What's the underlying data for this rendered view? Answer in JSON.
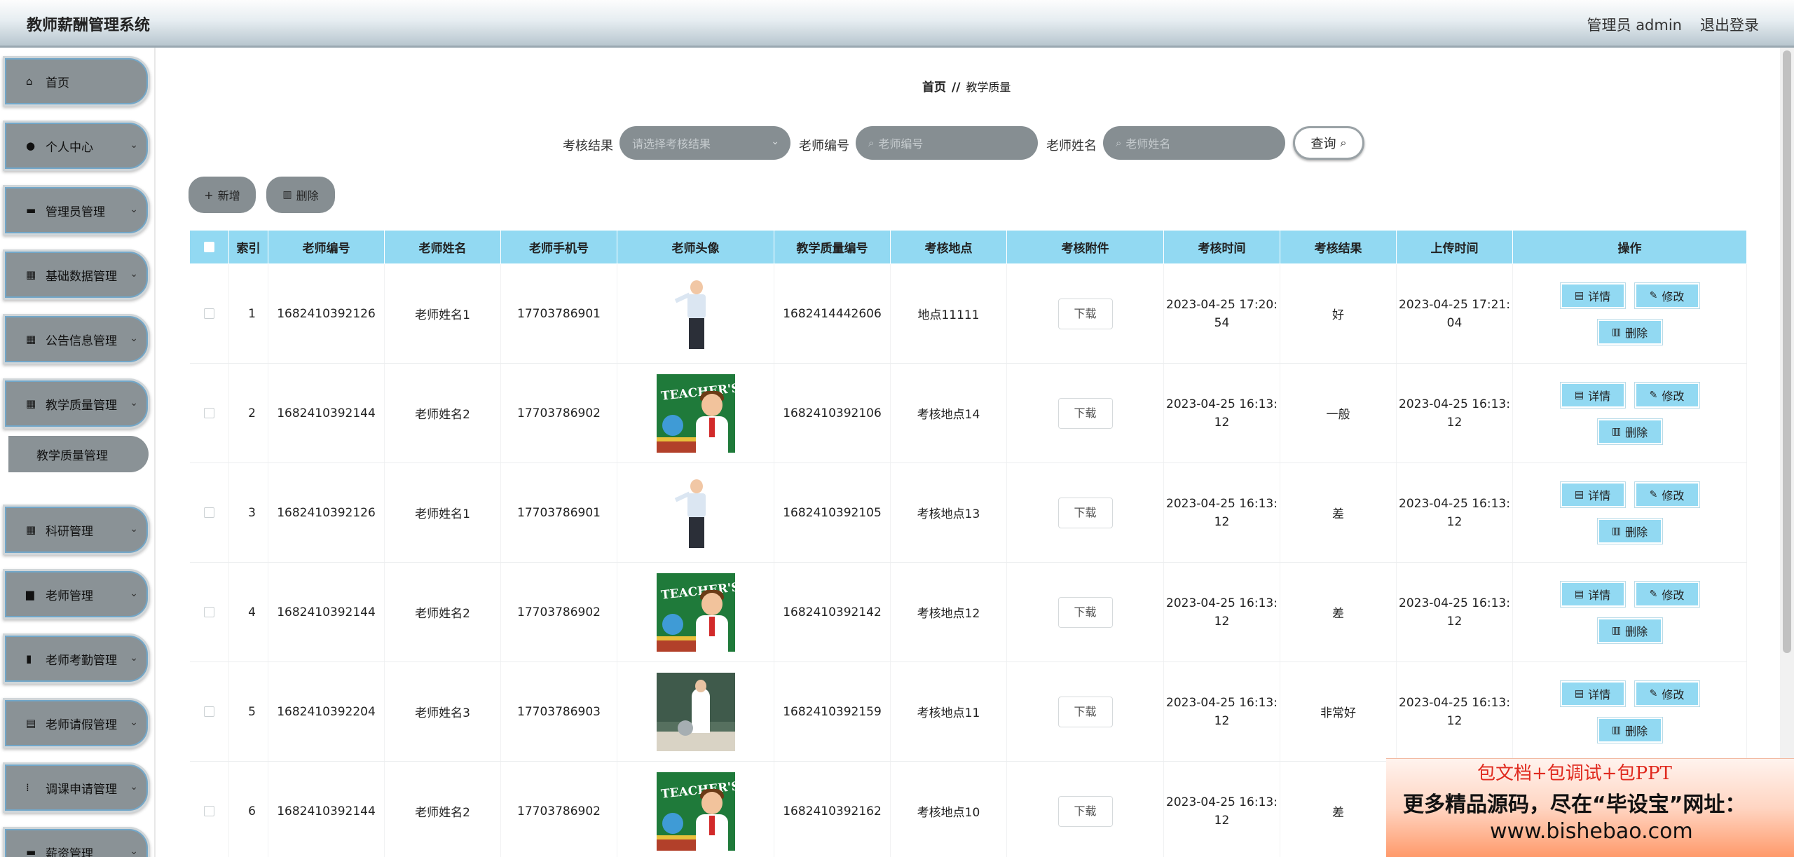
{
  "app": {
    "title": "教师薪酬管理系统",
    "user_label": "管理员 admin",
    "logout_label": "退出登录"
  },
  "sidebar": {
    "items": [
      {
        "label": "首页",
        "icon": "home-icon",
        "glyph": "⌂"
      },
      {
        "label": "个人中心",
        "icon": "user-icon",
        "glyph": "●"
      },
      {
        "label": "管理员管理",
        "icon": "chat-icon",
        "glyph": "▬"
      },
      {
        "label": "基础数据管理",
        "icon": "grid-icon",
        "glyph": "▦"
      },
      {
        "label": "公告信息管理",
        "icon": "grid-icon",
        "glyph": "▦"
      },
      {
        "label": "教学质量管理",
        "icon": "grid-icon",
        "glyph": "▦"
      },
      {
        "label": "科研管理",
        "icon": "grid-icon",
        "glyph": "▦"
      },
      {
        "label": "老师管理",
        "icon": "briefcase-icon",
        "glyph": "▆"
      },
      {
        "label": "老师考勤管理",
        "icon": "bar-chart-icon",
        "glyph": "▮"
      },
      {
        "label": "老师请假管理",
        "icon": "clipboard-icon",
        "glyph": "▤"
      },
      {
        "label": "调课申请管理",
        "icon": "apps-icon",
        "glyph": "⁞"
      },
      {
        "label": "薪资管理",
        "icon": "wallet-icon",
        "glyph": "▬"
      }
    ],
    "submenu": {
      "label": "教学质量管理"
    },
    "chevron": "⌄"
  },
  "breadcrumb": {
    "home": "首页",
    "separator": "//",
    "current": "教学质量"
  },
  "search": {
    "result_label": "考核结果",
    "result_placeholder": "请选择考核结果",
    "teacher_no_label": "老师编号",
    "teacher_no_placeholder": "老师编号",
    "teacher_name_label": "老师姓名",
    "teacher_name_placeholder": "老师姓名",
    "query_label": "查询"
  },
  "actions": {
    "add_label": "新增",
    "delete_label": "删除"
  },
  "table": {
    "headers": [
      "索引",
      "老师编号",
      "老师姓名",
      "老师手机号",
      "老师头像",
      "教学质量编号",
      "考核地点",
      "考核附件",
      "考核时间",
      "考核结果",
      "上传时间",
      "操作"
    ],
    "download_label": "下载",
    "detail_label": "详情",
    "edit_label": "修改",
    "delete_label": "删除",
    "rows": [
      {
        "index": "1",
        "teacher_no": "1682410392126",
        "teacher_name": "老师姓名1",
        "phone": "17703786901",
        "avatar": "man",
        "quality_no": "1682414442606",
        "location": "地点11111",
        "exam_time_a": "2023-04-25 17:20:",
        "exam_time_b": "54",
        "result": "好",
        "upload_time_a": "2023-04-25 17:21:",
        "upload_time_b": "04"
      },
      {
        "index": "2",
        "teacher_no": "1682410392144",
        "teacher_name": "老师姓名2",
        "phone": "17703786902",
        "avatar": "card",
        "quality_no": "1682410392106",
        "location": "考核地点14",
        "exam_time_a": "2023-04-25 16:13:",
        "exam_time_b": "12",
        "result": "一般",
        "upload_time_a": "2023-04-25 16:13:",
        "upload_time_b": "12"
      },
      {
        "index": "3",
        "teacher_no": "1682410392126",
        "teacher_name": "老师姓名1",
        "phone": "17703786901",
        "avatar": "man",
        "quality_no": "1682410392105",
        "location": "考核地点13",
        "exam_time_a": "2023-04-25 16:13:",
        "exam_time_b": "12",
        "result": "差",
        "upload_time_a": "2023-04-25 16:13:",
        "upload_time_b": "12"
      },
      {
        "index": "4",
        "teacher_no": "1682410392144",
        "teacher_name": "老师姓名2",
        "phone": "17703786902",
        "avatar": "card",
        "quality_no": "1682410392142",
        "location": "考核地点12",
        "exam_time_a": "2023-04-25 16:13:",
        "exam_time_b": "12",
        "result": "差",
        "upload_time_a": "2023-04-25 16:13:",
        "upload_time_b": "12"
      },
      {
        "index": "5",
        "teacher_no": "1682410392204",
        "teacher_name": "老师姓名3",
        "phone": "17703786903",
        "avatar": "photo",
        "quality_no": "1682410392159",
        "location": "考核地点11",
        "exam_time_a": "2023-04-25 16:13:",
        "exam_time_b": "12",
        "result": "非常好",
        "upload_time_a": "2023-04-25 16:13:",
        "upload_time_b": "12"
      },
      {
        "index": "6",
        "teacher_no": "1682410392144",
        "teacher_name": "老师姓名2",
        "phone": "17703786902",
        "avatar": "card",
        "quality_no": "1682410392162",
        "location": "考核地点10",
        "exam_time_a": "2023-04-25 16:13:",
        "exam_time_b": "12",
        "result": "差",
        "upload_time_a": "",
        "upload_time_b": ""
      }
    ]
  },
  "avatar_card_text": "TEACHER'S",
  "ad": {
    "line1": "包文档+包调试+包PPT",
    "line2": "更多精品源码，尽在“毕设宝”网址：",
    "line3": "www.bishebao.com"
  },
  "colors": {
    "table_header": "#92d9f2",
    "pill_gray": "#868e92",
    "sidebar_item": "#8a9296"
  }
}
